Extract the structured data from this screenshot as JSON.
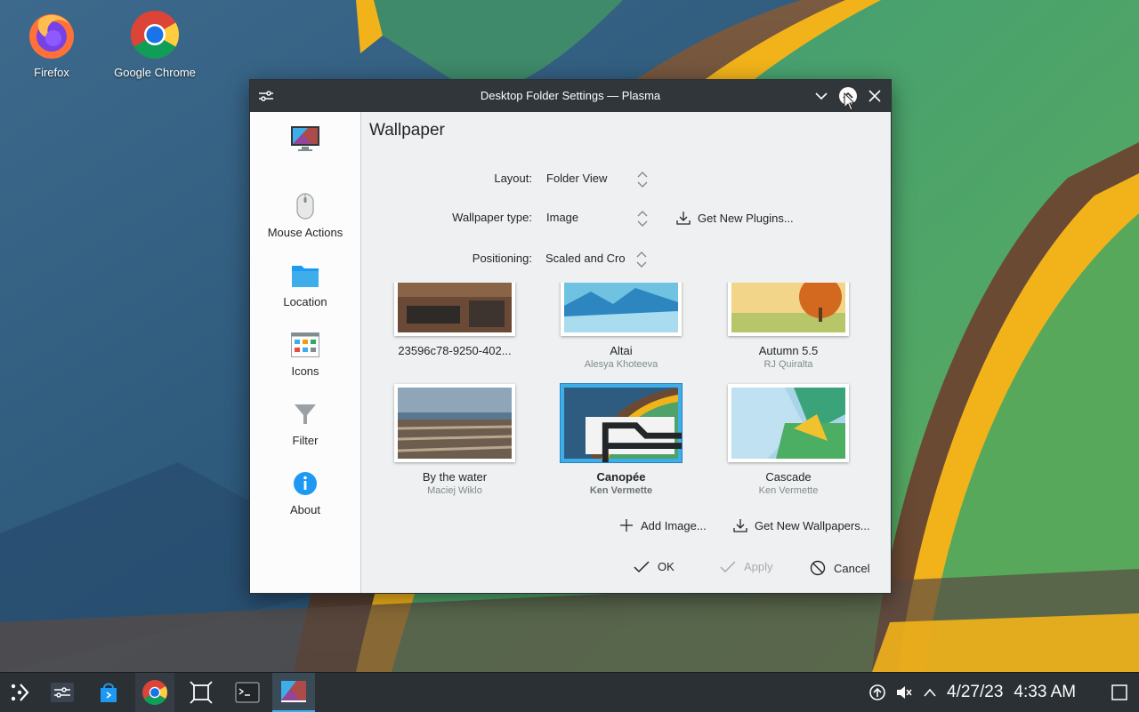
{
  "desktop": {
    "icons": [
      {
        "label": "Firefox",
        "icon": "firefox-icon"
      },
      {
        "label": "Google Chrome",
        "icon": "chrome-icon"
      }
    ]
  },
  "dialog": {
    "title": "Desktop Folder Settings — Plasma",
    "sidebar": [
      {
        "label": "",
        "icon": "monitor-icon"
      },
      {
        "label": "Mouse Actions",
        "icon": "mouse-icon"
      },
      {
        "label": "Location",
        "icon": "folder-icon"
      },
      {
        "label": "Icons",
        "icon": "icons-grid-icon"
      },
      {
        "label": "Filter",
        "icon": "funnel-icon"
      },
      {
        "label": "About",
        "icon": "info-icon"
      }
    ],
    "page_title": "Wallpaper",
    "form": {
      "layout_label": "Layout:",
      "layout_value": "Folder View",
      "type_label": "Wallpaper type:",
      "type_value": "Image",
      "get_plugins": "Get New Plugins...",
      "positioning_label": "Positioning:",
      "positioning_value": "Scaled and Cropped"
    },
    "wallpapers": [
      {
        "name": "23596c78-9250-402...",
        "author": ""
      },
      {
        "name": "Altai",
        "author": "Alesya Khoteeva"
      },
      {
        "name": "Autumn 5.5",
        "author": "RJ Quiralta"
      },
      {
        "name": "By the water",
        "author": "Maciej Wiklo"
      },
      {
        "name": "Canopée",
        "author": "Ken Vermette",
        "selected": true
      },
      {
        "name": "Cascade",
        "author": "Ken Vermette"
      }
    ],
    "add_image": "Add Image...",
    "get_wallpapers": "Get New Wallpapers...",
    "buttons": {
      "ok": "OK",
      "apply": "Apply",
      "cancel": "Cancel"
    }
  },
  "taskbar": {
    "date": "4/27/23",
    "time": "4:33 AM"
  },
  "colors": {
    "accent": "#3daee9",
    "titlebar": "#31363b",
    "taskbar": "#2b3035"
  }
}
